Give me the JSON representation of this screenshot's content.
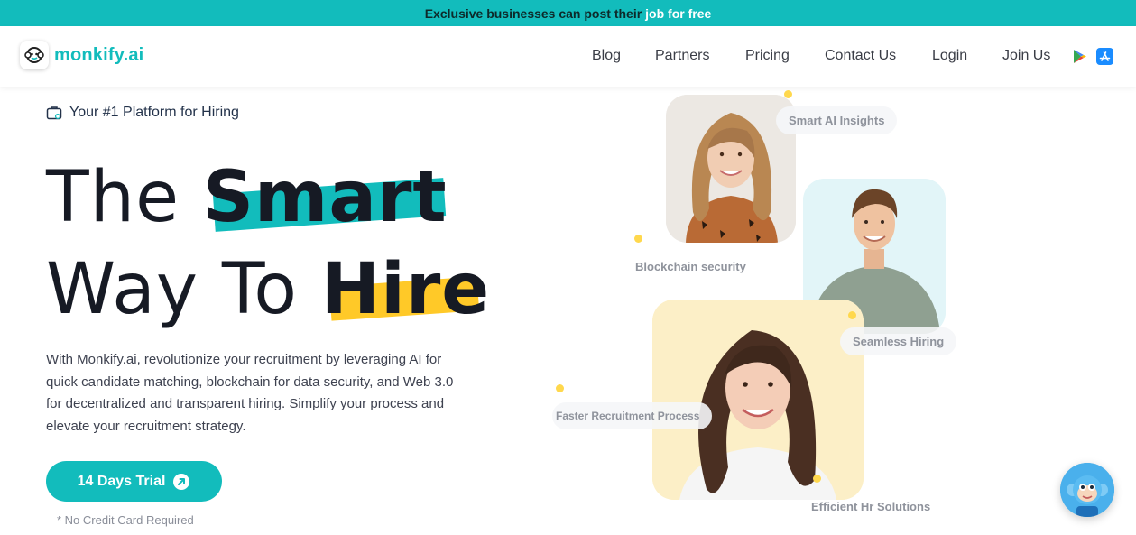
{
  "announcement": {
    "text": "Exclusive businesses can post their",
    "highlight": "job for free"
  },
  "brand": {
    "name": "monkify.ai",
    "accent_color": "#12bcbc"
  },
  "nav": {
    "items": [
      "Blog",
      "Partners",
      "Pricing",
      "Contact Us",
      "Login",
      "Join Us"
    ],
    "store_icons": [
      "google-play-icon",
      "app-store-icon"
    ]
  },
  "hero": {
    "tagline": "Your #1 Platform for Hiring",
    "headline": {
      "line1_plain": "The",
      "line1_accent": "Smart",
      "line2_plain": "Way To",
      "line2_accent": "Hire"
    },
    "description": "With Monkify.ai, revolutionize your recruitment by leveraging AI for quick candidate matching, blockchain for data security, and Web 3.0 for decentralized and transparent hiring. Simplify your process and elevate your recruitment strategy.",
    "cta_label": "14 Days Trial",
    "cta_note": "* No Credit Card Required"
  },
  "features": {
    "smart_ai": "Smart AI Insights",
    "blockchain": "Blockchain security",
    "seamless": "Seamless Hiring",
    "faster": "Faster Recruitment Process",
    "efficient": "Efficient Hr Solutions"
  },
  "colors": {
    "teal": "#12bcbc",
    "yellow": "#ffc928",
    "dark": "#161a24"
  }
}
